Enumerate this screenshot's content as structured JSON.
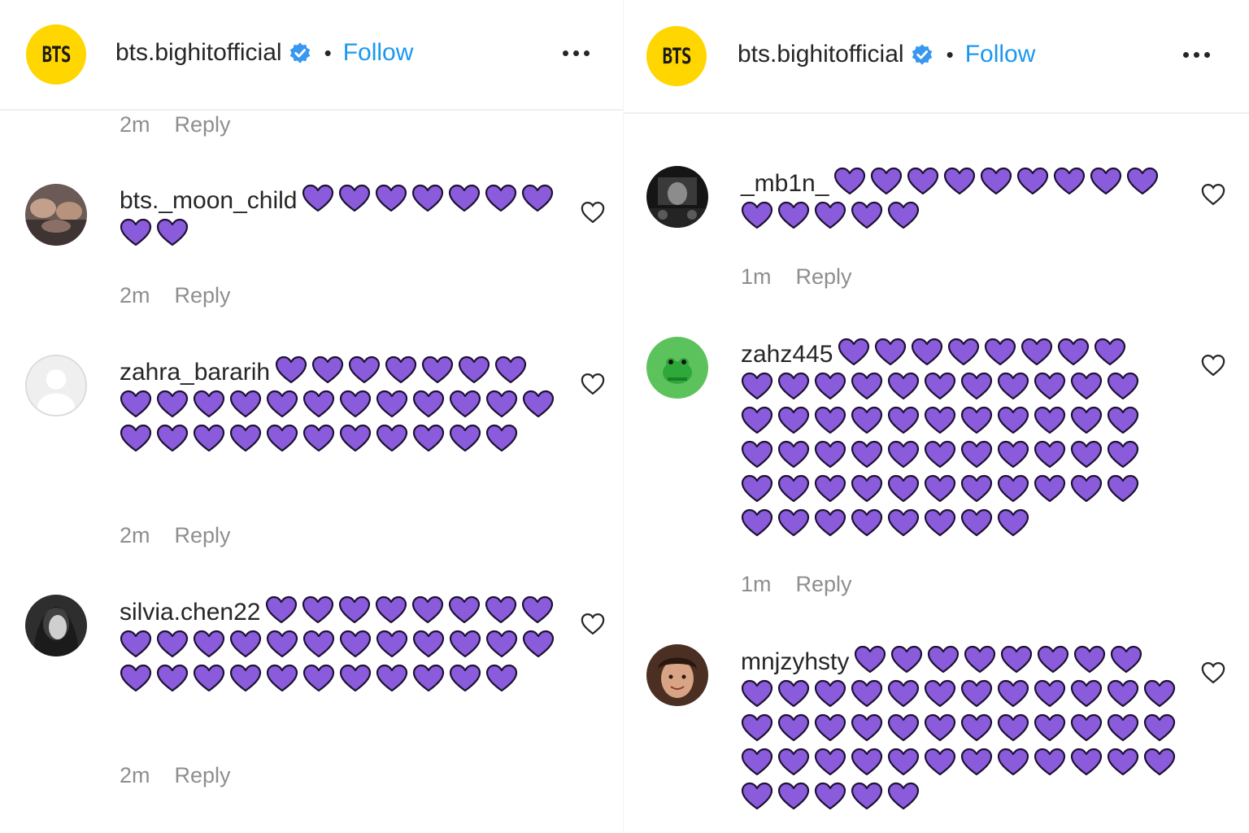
{
  "header": {
    "logo_text": "BTS",
    "username": "bts.bighitofficial",
    "separator": "•",
    "follow_label": "Follow",
    "verified_color": "#3897f0",
    "follow_color": "#1a98f0",
    "logo_color": "#ffd600"
  },
  "heart_color": "#8a5cdc",
  "left_panel": {
    "top_meta": {
      "time": "2m",
      "reply": "Reply"
    },
    "comments": [
      {
        "username": "bts._moon_child",
        "hearts": 9,
        "time": "2m",
        "reply": "Reply"
      },
      {
        "username": "zahra_bararih",
        "hearts": 30,
        "time": "2m",
        "reply": "Reply"
      },
      {
        "username": "silvia.chen22",
        "hearts": 31,
        "time": "2m",
        "reply": "Reply"
      }
    ]
  },
  "right_panel": {
    "comments": [
      {
        "username": "_mb1n_",
        "hearts": 14,
        "time": "1m",
        "reply": "Reply"
      },
      {
        "username": "zahz445",
        "hearts": 60,
        "time": "1m",
        "reply": "Reply"
      },
      {
        "username": "mnjzyhsty",
        "hearts": 49
      }
    ]
  }
}
